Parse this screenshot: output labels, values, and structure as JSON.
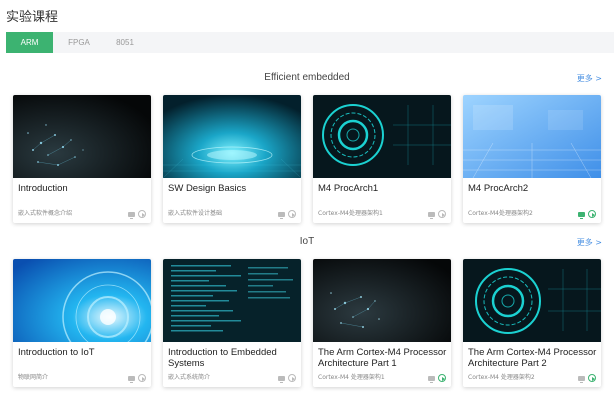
{
  "page": {
    "title": "实验课程"
  },
  "tabs": [
    {
      "label": "ARM",
      "active": true
    },
    {
      "label": "FPGA",
      "active": false
    },
    {
      "label": "8051",
      "active": false
    }
  ],
  "sections": [
    {
      "title": "Efficient embedded",
      "more": "更多 >",
      "cards": [
        {
          "title": "Introduction",
          "subtitle": "嵌入式软件概念介绍",
          "thumbnail": "dark-particles",
          "status": "default"
        },
        {
          "title": "SW Design Basics",
          "subtitle": "嵌入式软件设计基础",
          "thumbnail": "cyan-glow-platform",
          "status": "default"
        },
        {
          "title": "M4 ProcArch1",
          "subtitle": "Cortex-M4处理器架构1",
          "thumbnail": "cyan-hud-ring",
          "status": "default"
        },
        {
          "title": "M4 ProcArch2",
          "subtitle": "Cortex-M4处理器架构2",
          "thumbnail": "light-blue-grid",
          "status": "active"
        }
      ]
    },
    {
      "title": "IoT",
      "more": "更多 >",
      "cards": [
        {
          "title": "Introduction to IoT",
          "subtitle": "物联网简介",
          "thumbnail": "blue-swirl",
          "status": "default"
        },
        {
          "title": "Introduction to Embedded Systems",
          "subtitle": "嵌入式系统简介",
          "thumbnail": "code-screen",
          "status": "default"
        },
        {
          "title": "The Arm Cortex-M4 Processor Architecture Part 1",
          "subtitle": "Cortex-M4 处理器架构1",
          "thumbnail": "dark-particles",
          "status": "partial"
        },
        {
          "title": "The Arm Cortex-M4 Processor Architecture Part 2",
          "subtitle": "Cortex-M4 处理器架构2",
          "thumbnail": "cyan-hud-ring",
          "status": "partial"
        }
      ]
    }
  ],
  "colors": {
    "accent": "#3cb371",
    "link": "#4a90e2",
    "tabbar_bg": "#f4f5f7"
  }
}
